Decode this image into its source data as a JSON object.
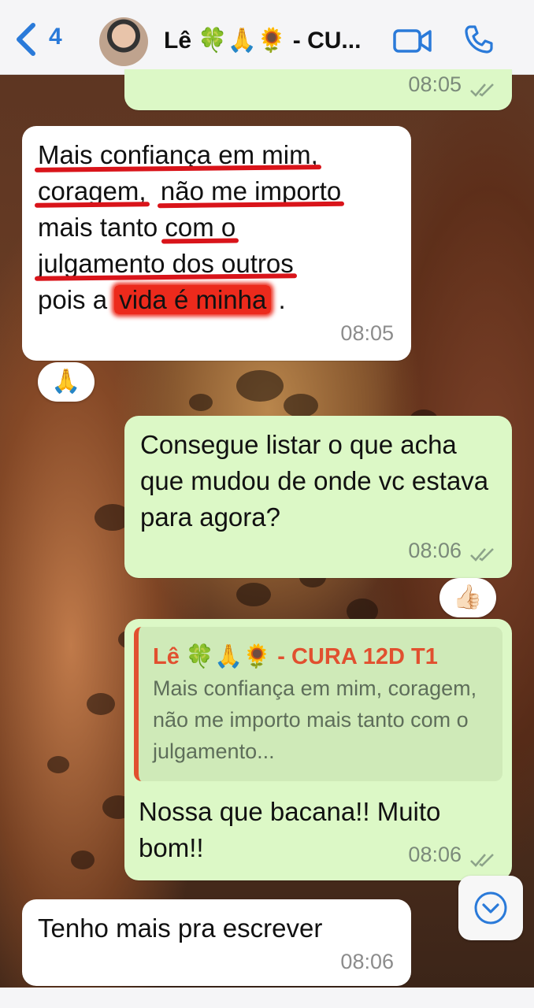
{
  "header": {
    "back_count": "4",
    "chat_title": "Lê 🍀🙏🌻 - CU..."
  },
  "messages": [
    {
      "direction": "out",
      "time": "08:05"
    },
    {
      "direction": "in",
      "lines": [
        "Mais confiança em mim,",
        "coragem,",
        "não me importo",
        "mais tanto",
        "com o",
        "julgamento dos outros",
        "pois a",
        "vida é minha",
        "."
      ],
      "time": "08:05",
      "reaction": "🙏"
    },
    {
      "direction": "out",
      "text": "Consegue listar o que acha que mudou de onde vc estava para agora?",
      "time": "08:06",
      "reaction": "👍🏻"
    },
    {
      "direction": "out",
      "quote": {
        "author": "Lê 🍀🙏🌻 - CURA 12D T1",
        "text": "Mais confiança em mim, coragem,  não me importo mais tanto com o julgamento..."
      },
      "text": "Nossa que bacana!! Muito bom!!",
      "time": "08:06"
    },
    {
      "direction": "in",
      "text": "Tenho mais pra escrever",
      "time": "08:06"
    }
  ],
  "colors": {
    "outgoing_bubble": "#dcf8c6",
    "incoming_bubble": "#ffffff",
    "accent_blue": "#2a7ad9",
    "quote_author": "#e1502f",
    "annotation_red": "#d9141a"
  },
  "icons": [
    "chevron-left-icon",
    "video-call-icon",
    "phone-icon",
    "double-check-icon",
    "chevron-down-icon"
  ]
}
